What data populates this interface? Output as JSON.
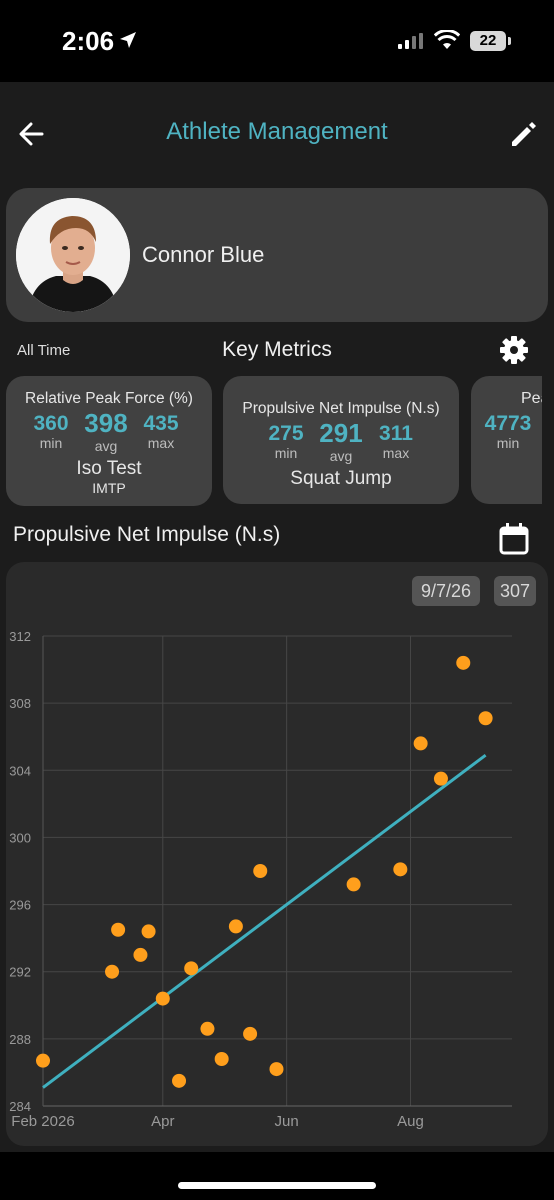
{
  "status_bar": {
    "time": "2:06",
    "battery": "22"
  },
  "header": {
    "title": "Athlete Management"
  },
  "athlete": {
    "name": "Connor Blue"
  },
  "metrics_section": {
    "range": "All Time",
    "title": "Key Metrics"
  },
  "metric_cards": [
    {
      "title": "Relative Peak Force (%)",
      "min": "360",
      "avg": "398",
      "max": "435",
      "min_label": "min",
      "avg_label": "avg",
      "max_label": "max",
      "test": "Iso Test",
      "subtest": "IMTP"
    },
    {
      "title": "Propulsive Net Impulse (N.s)",
      "min": "275",
      "avg": "291",
      "max": "311",
      "min_label": "min",
      "avg_label": "avg",
      "max_label": "max",
      "test": "Squat Jump",
      "subtest": ""
    },
    {
      "title": "Pea",
      "min": "4773",
      "min_label": "min"
    }
  ],
  "chart_header": {
    "title": "Propulsive Net Impulse (N.s)",
    "selected_date": "9/7/26",
    "selected_value": "307"
  },
  "colors": {
    "accent": "#4fb3c2",
    "point": "#ff9f1c",
    "trend": "#3fb0bf"
  },
  "chart_data": {
    "type": "scatter",
    "title": "Propulsive Net Impulse (N.s)",
    "xlabel": "",
    "ylabel": "",
    "x_axis": {
      "type": "date",
      "min": "2026-02-01",
      "max": "2026-09-20",
      "tick_labels": [
        "Feb 2026",
        "Apr",
        "Jun",
        "Aug"
      ],
      "ticks": [
        "2026-02-01",
        "2026-04-01",
        "2026-06-01",
        "2026-08-01"
      ]
    },
    "ylim": [
      284,
      312
    ],
    "yticks": [
      284,
      288,
      292,
      296,
      300,
      304,
      308,
      312
    ],
    "grid": true,
    "points": [
      {
        "x": "2026-02-01",
        "y": 286.7
      },
      {
        "x": "2026-03-07",
        "y": 292.0
      },
      {
        "x": "2026-03-10",
        "y": 294.5
      },
      {
        "x": "2026-03-21",
        "y": 293.0
      },
      {
        "x": "2026-03-25",
        "y": 294.4
      },
      {
        "x": "2026-04-01",
        "y": 290.4
      },
      {
        "x": "2026-04-09",
        "y": 285.5
      },
      {
        "x": "2026-04-15",
        "y": 292.2
      },
      {
        "x": "2026-04-23",
        "y": 288.6
      },
      {
        "x": "2026-04-30",
        "y": 286.8
      },
      {
        "x": "2026-05-07",
        "y": 294.7
      },
      {
        "x": "2026-05-14",
        "y": 288.3
      },
      {
        "x": "2026-05-19",
        "y": 298.0
      },
      {
        "x": "2026-05-27",
        "y": 286.2
      },
      {
        "x": "2026-07-04",
        "y": 297.2
      },
      {
        "x": "2026-07-27",
        "y": 298.1
      },
      {
        "x": "2026-08-06",
        "y": 305.6
      },
      {
        "x": "2026-08-16",
        "y": 303.5
      },
      {
        "x": "2026-08-27",
        "y": 310.4
      },
      {
        "x": "2026-09-07",
        "y": 307.1
      }
    ],
    "trendline": {
      "start": {
        "x": "2026-02-01",
        "y": 285.1
      },
      "end": {
        "x": "2026-09-07",
        "y": 304.9
      }
    }
  }
}
